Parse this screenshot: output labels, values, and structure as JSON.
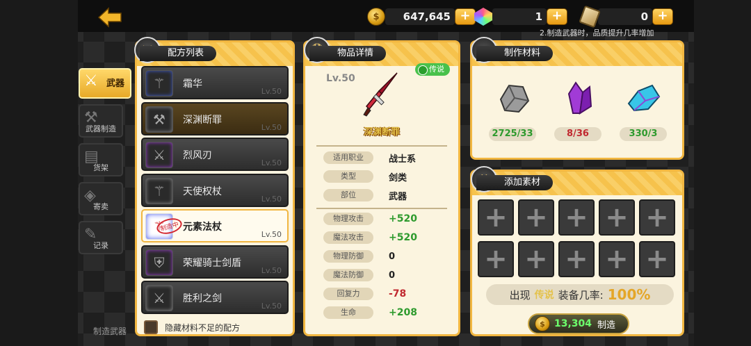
{
  "topbar": {
    "coins": "647,645",
    "gems": "1",
    "scrolls": "0",
    "plus": "+",
    "ticker": "2.制造武器时，品质提升几率增加"
  },
  "tabs": [
    {
      "label": "武器",
      "icon": "swords-icon",
      "glyph": "⚔",
      "active": true
    },
    {
      "label": "武器制造",
      "icon": "hammer-icon",
      "glyph": "⚒"
    },
    {
      "label": "货架",
      "icon": "shelf-icon",
      "glyph": "▤"
    },
    {
      "label": "寄卖",
      "icon": "bag-icon",
      "glyph": "◈"
    },
    {
      "label": "记录",
      "icon": "scroll-icon",
      "glyph": "✎"
    }
  ],
  "recipe_panel": {
    "title": "配方列表",
    "items": [
      {
        "name": "霜华",
        "lv": "Lv.50",
        "style": "blue"
      },
      {
        "name": "深渊断罪",
        "lv": "Lv.50",
        "style": "gold"
      },
      {
        "name": "烈风刃",
        "lv": "Lv.50",
        "style": "purple"
      },
      {
        "name": "天使权杖",
        "lv": "Lv.50",
        "style": "grey"
      },
      {
        "name": "元素法杖",
        "lv": "Lv.50",
        "style": "selected",
        "stamp": "制造中"
      },
      {
        "name": "荣耀骑士剑盾",
        "lv": "Lv.50",
        "style": "purple"
      },
      {
        "name": "胜利之剑",
        "lv": "Lv.50",
        "style": "grey"
      }
    ],
    "hide_label": "隐藏材料不足的配方"
  },
  "detail_panel": {
    "title": "物品详情",
    "level": "Lv.50",
    "rarity": "传说",
    "item_name": "深渊断罪",
    "info": [
      {
        "label": "适用职业",
        "value": "战士系"
      },
      {
        "label": "类型",
        "value": "剑类"
      },
      {
        "label": "部位",
        "value": "武器"
      }
    ],
    "stats": [
      {
        "label": "物理攻击",
        "value": "+520",
        "tone": "green"
      },
      {
        "label": "魔法攻击",
        "value": "+520",
        "tone": "green"
      },
      {
        "label": "物理防御",
        "value": "0",
        "tone": ""
      },
      {
        "label": "魔法防御",
        "value": "0",
        "tone": ""
      },
      {
        "label": "回复力",
        "value": "-78",
        "tone": "red"
      },
      {
        "label": "生命",
        "value": "+208",
        "tone": "green"
      }
    ]
  },
  "materials_panel": {
    "title": "制作材料",
    "items": [
      {
        "icon": "ore-icon",
        "count": "2725/33",
        "status": "ok",
        "color": "#bfbfbf"
      },
      {
        "icon": "purple-crystal-icon",
        "count": "8/36",
        "status": "bad",
        "color": "#a13bd6"
      },
      {
        "icon": "blue-crystal-icon",
        "count": "330/3",
        "status": "ok",
        "color": "#38c6e8"
      }
    ]
  },
  "add_panel": {
    "title": "添加素材",
    "slot_glyph": "+",
    "prob_prefix": "出现",
    "prob_quality": "传说",
    "prob_mid": "装备几率:",
    "prob_value": "100%",
    "craft_cost": "13,304",
    "craft_label": "制造"
  },
  "bottom": {
    "hint": "制造武器",
    "hint2": "2.制造武器"
  }
}
